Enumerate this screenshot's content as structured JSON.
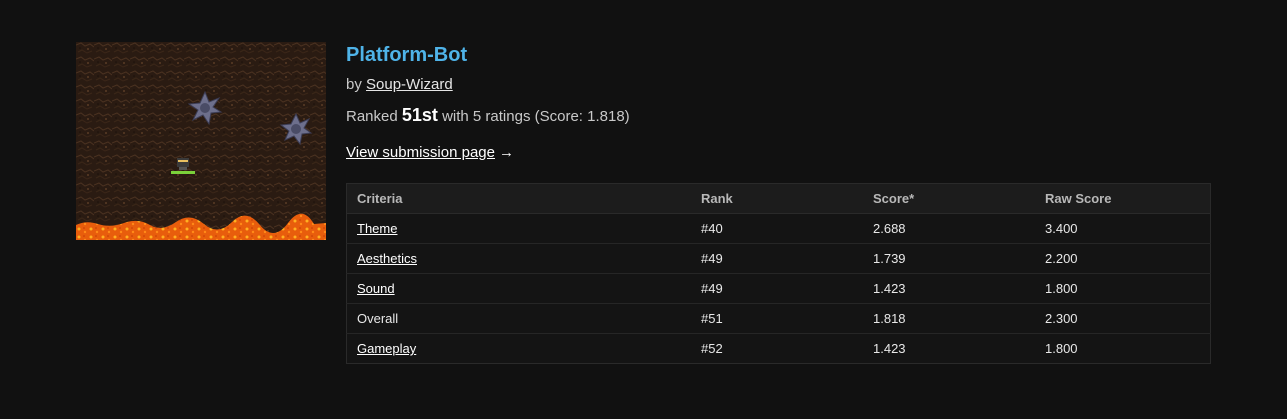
{
  "game": {
    "title": "Platform-Bot",
    "by_prefix": "by",
    "author": "Soup-Wizard",
    "ranked_prefix": "Ranked",
    "rank": "51st",
    "ranked_suffix": "with 5 ratings (Score: 1.818)",
    "view_link": "View submission page",
    "view_arrow": "→"
  },
  "thumbnail": {
    "icon": "game-screenshot",
    "colors": {
      "background": "#2a1a12",
      "lava": "#f06a10",
      "spike": "#6a6a86",
      "platform": "#7bd13a"
    }
  },
  "table": {
    "headers": [
      "Criteria",
      "Rank",
      "Score*",
      "Raw Score"
    ],
    "rows": [
      {
        "criteria": "Theme",
        "rank": "#40",
        "score": "2.688",
        "raw": "3.400",
        "link": true
      },
      {
        "criteria": "Aesthetics",
        "rank": "#49",
        "score": "1.739",
        "raw": "2.200",
        "link": true
      },
      {
        "criteria": "Sound",
        "rank": "#49",
        "score": "1.423",
        "raw": "1.800",
        "link": true
      },
      {
        "criteria": "Overall",
        "rank": "#51",
        "score": "1.818",
        "raw": "2.300",
        "link": false
      },
      {
        "criteria": "Gameplay",
        "rank": "#52",
        "score": "1.423",
        "raw": "1.800",
        "link": true
      }
    ]
  },
  "colors": {
    "page_bg": "#111111",
    "title": "#4fb3e8",
    "text": "#c9c9c9"
  }
}
